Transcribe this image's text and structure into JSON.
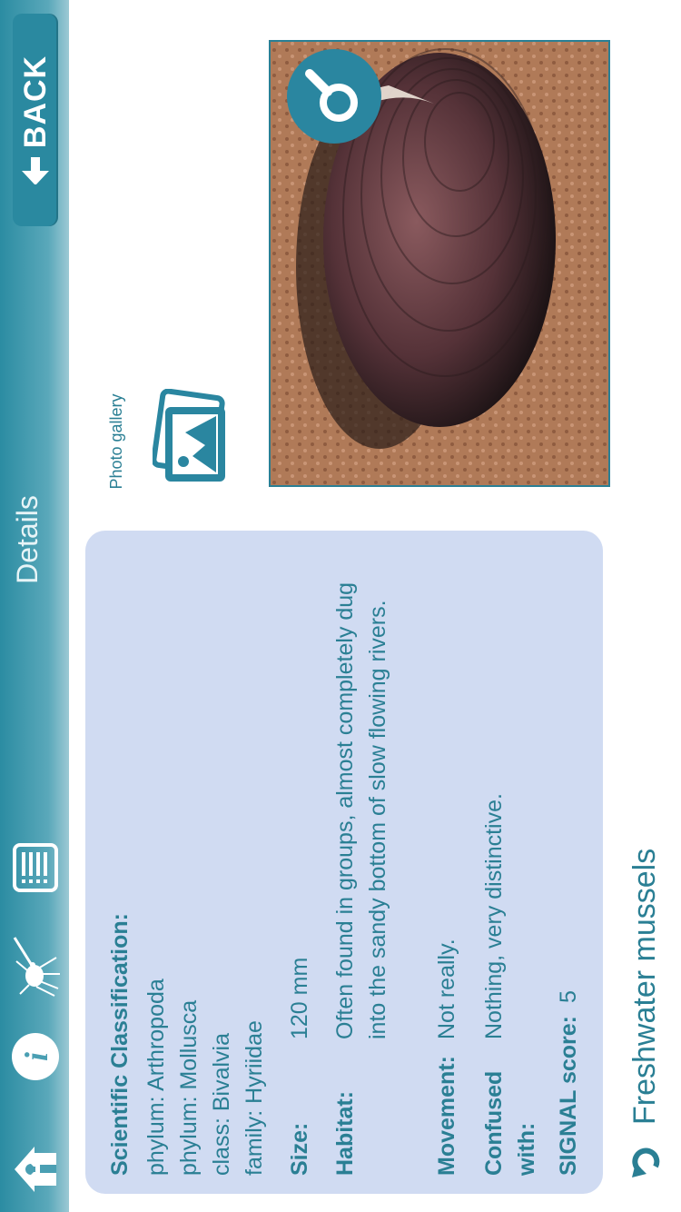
{
  "header": {
    "back_label": "BACK",
    "title": "Details",
    "icons": [
      "home-icon",
      "info-icon",
      "mosquito-icon",
      "list-icon"
    ]
  },
  "species": {
    "title": "Freshwater mussels",
    "classification_heading": "Scientific Classification:",
    "classification": [
      "phylum: Arthropoda",
      "phylum: Mollusca",
      "class: Bivalvia",
      "family: Hyriidae"
    ],
    "fields": [
      {
        "label": "Size:",
        "value": "120 mm"
      },
      {
        "label": "Habitat:",
        "value": "Often found in groups, almost completely dug into the sandy bottom of slow flowing rivers."
      },
      {
        "label": "Movement:",
        "value": "Not really."
      },
      {
        "label": "Confused with:",
        "value": "Nothing, very distinctive."
      },
      {
        "label": "SIGNAL score:",
        "value": "5"
      }
    ]
  },
  "gallery": {
    "label": "Photo gallery"
  },
  "colors": {
    "accent": "#2a7f94",
    "card": "#d0dbf2",
    "bar": "#2b8ca2"
  }
}
